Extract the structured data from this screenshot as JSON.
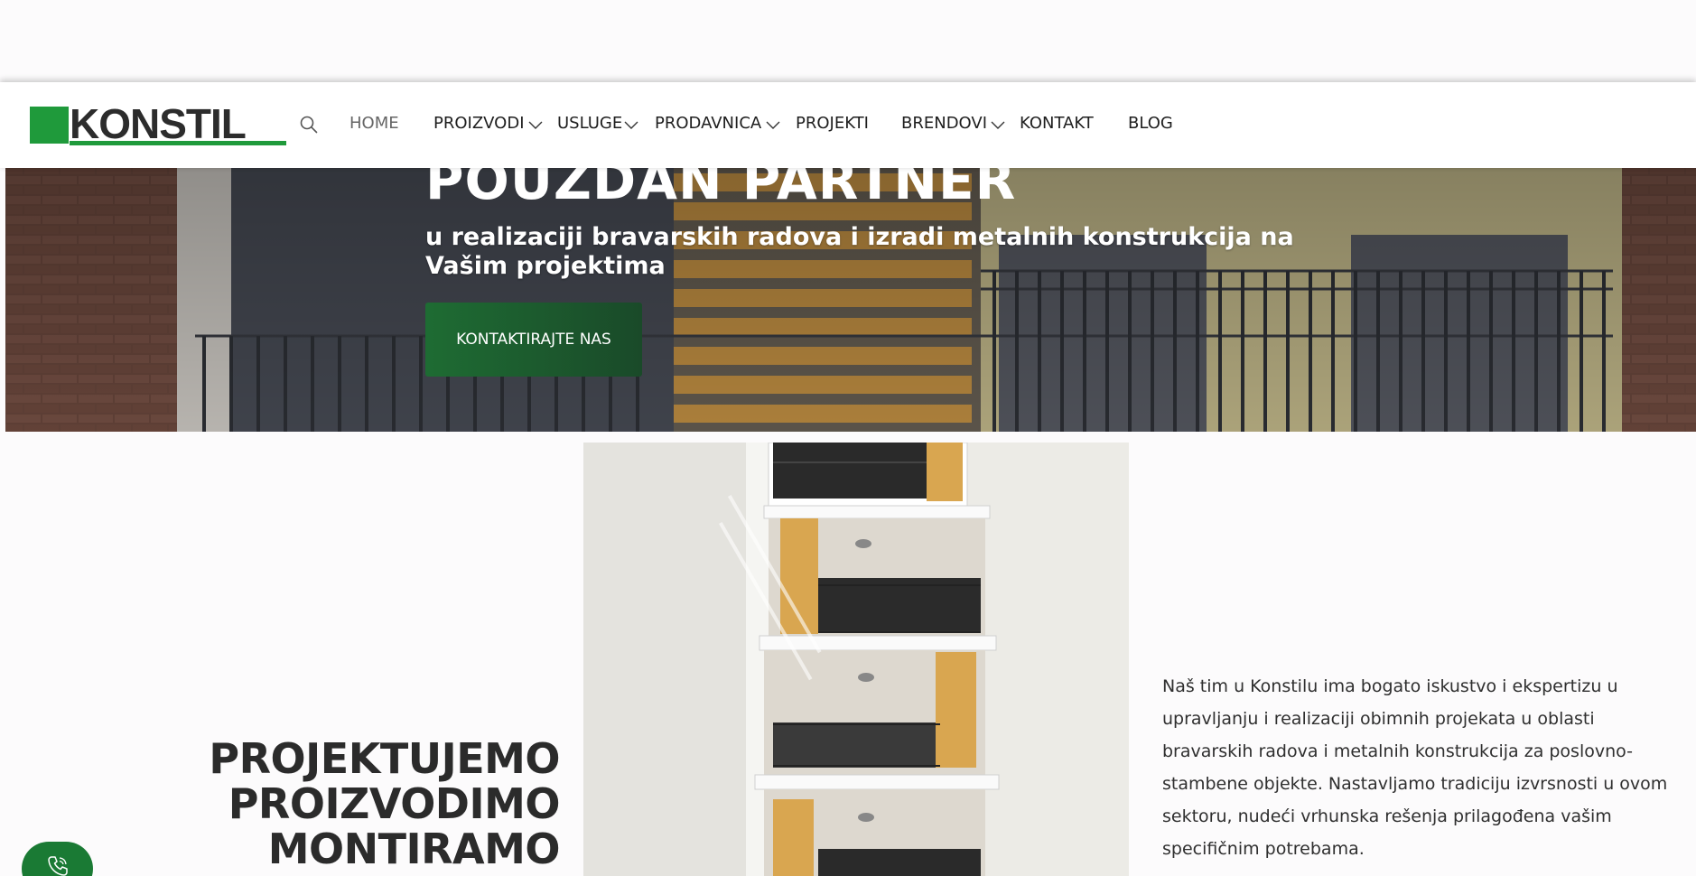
{
  "header": {
    "logo_text": "KONSTIL",
    "nav": [
      {
        "label": "HOME",
        "active": true
      },
      {
        "label": "PROIZVODI",
        "has_dropdown": true
      },
      {
        "label": "USLUGE",
        "has_dropdown": true
      },
      {
        "label": "PRODAVNICA",
        "has_dropdown": true
      },
      {
        "label": "PROJEKTI"
      },
      {
        "label": "BRENDOVI",
        "has_dropdown": true
      },
      {
        "label": "KONTAKT"
      },
      {
        "label": "BLOG"
      }
    ]
  },
  "hero": {
    "title": "POUZDAN PARTNER",
    "subtitle": "u realizaciji bravarskih radova i izradi metalnih konstrukcija na Vašim projektima",
    "cta_label": "KONTAKTIRAJTE NAS"
  },
  "intro": {
    "lines": [
      "PROJEKTUJEMO",
      "PROIZVODIMO",
      "MONTIRAMO"
    ],
    "description": "Naš tim u Konstilu ima bogato iskustvo i ekspertizu u upravljanju i realizaciji obimnih projekata u oblasti bravarskih radova i metalnih konstrukcija za poslovno-stambene objekte. Nastavljamo tradiciju izvrsnosti u ovom sektoru, nudeći vrhunska rešenja prilagođena vašim specifičnim potrebama."
  },
  "colors": {
    "brand_green": "#1f9a3b",
    "cta_green": "#1e6c33",
    "text_dark": "#2b2b2b"
  },
  "icons": {
    "search": "search-icon",
    "chevron": "chevron-down-icon",
    "phone": "phone-icon"
  }
}
